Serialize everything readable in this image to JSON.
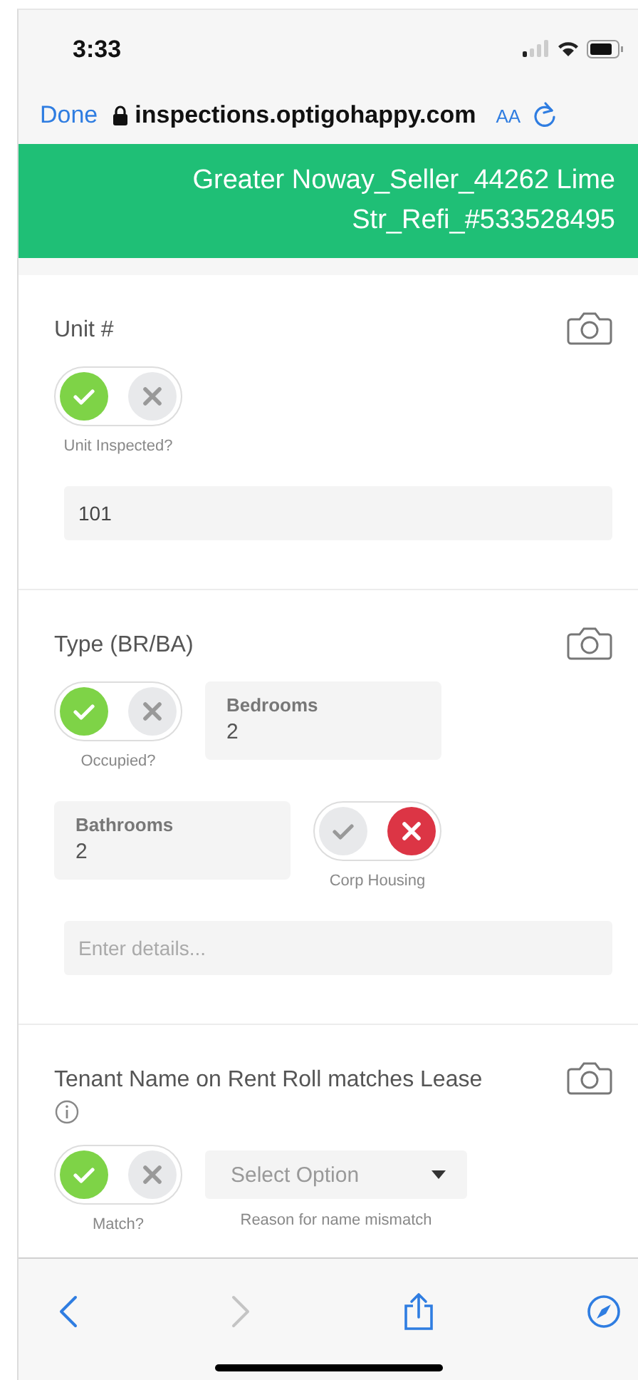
{
  "status_bar": {
    "time": "3:33"
  },
  "browser_bar": {
    "done": "Done",
    "url": "inspections.optigohappy.com",
    "text_size": "AA"
  },
  "header": {
    "title": "Greater Noway_Seller_44262 Lime Str_Refi_#533528495"
  },
  "sections": [
    {
      "title": "Unit #",
      "info": false,
      "rows": [
        [
          {
            "kind": "toggle",
            "caption": "Unit Inspected?",
            "checked": true
          }
        ],
        [
          {
            "kind": "text",
            "value": "101"
          }
        ]
      ]
    },
    {
      "title": "Type (BR/BA)",
      "info": false,
      "rows": [
        [
          {
            "kind": "toggle",
            "caption": "Occupied?",
            "checked": true
          },
          {
            "kind": "number",
            "label": "Bedrooms",
            "value": "2"
          }
        ],
        [
          {
            "kind": "number",
            "label": "Bathrooms",
            "value": "2"
          },
          {
            "kind": "toggle",
            "caption": "Corp Housing",
            "checked": false
          }
        ],
        [
          {
            "kind": "text",
            "placeholder": "Enter details..."
          }
        ]
      ]
    },
    {
      "title": "Tenant Name on Rent Roll matches Lease",
      "info": true,
      "rows": [
        [
          {
            "kind": "toggle",
            "caption": "Match?",
            "checked": true
          },
          {
            "kind": "select",
            "placeholder": "Select Option",
            "caption": "Reason for name mismatch"
          }
        ]
      ]
    }
  ]
}
